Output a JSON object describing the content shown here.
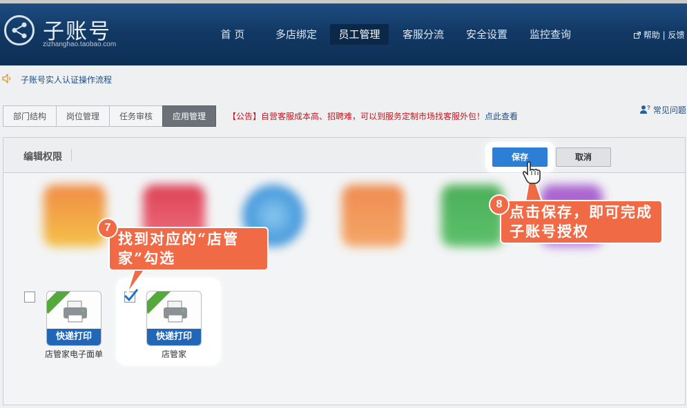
{
  "header": {
    "title": "子账号",
    "subtitle": "zizhanghao.taobao.com",
    "nav": [
      "首 页",
      "多店绑定",
      "员工管理",
      "客服分流",
      "安全设置",
      "监控查询"
    ],
    "active_nav": "员工管理",
    "help_links": "帮助 | 反馈"
  },
  "notice": {
    "text": "子账号实人认证操作流程"
  },
  "tabs": {
    "items": [
      "部门结构",
      "岗位管理",
      "任务审核",
      "应用管理"
    ],
    "active": "应用管理"
  },
  "announcement": {
    "prefix": "【公告】",
    "text": "自营客服成本高、招聘难，可以到服务定制市场找客服外包！",
    "link": "点此查看"
  },
  "faq": {
    "label": "常见问题"
  },
  "panel": {
    "title": "编辑权限",
    "save_label": "保存",
    "cancel_label": "取消"
  },
  "apps": [
    {
      "name": "店管家电子面单",
      "icon_label": "快递打印",
      "checked": false
    },
    {
      "name": "店管家",
      "icon_label": "快递打印",
      "checked": true
    }
  ],
  "callouts": {
    "step7": {
      "number": "7",
      "text": "找到对应的“店管家”勾选"
    },
    "step8": {
      "number": "8",
      "text": "点击保存，即可完成子账号授权"
    }
  },
  "colors": {
    "header": "#123a66",
    "primary_button": "#2d7fd6",
    "callout": "#f16a46",
    "announcement_red": "#c8141e",
    "link_blue": "#1d4e85"
  },
  "icons": {
    "logo": "share-nodes-icon",
    "speaker": "speaker-icon",
    "external_link": "external-link-icon",
    "faq": "user-question-icon",
    "printer": "printer-icon",
    "cursor": "hand-pointer-icon"
  }
}
